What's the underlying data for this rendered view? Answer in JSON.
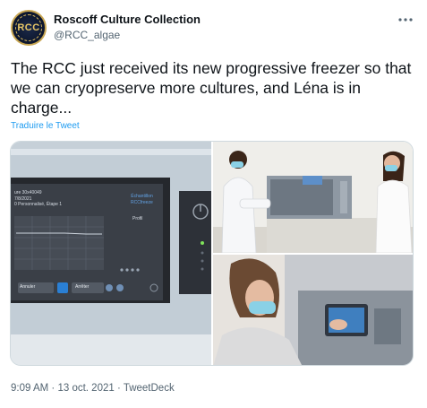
{
  "author": {
    "display_name": "Roscoff Culture Collection",
    "handle": "@RCC_algae",
    "avatar_text": "RCC"
  },
  "tweet": {
    "text": "The RCC just received its new progressive freezer so that we can cryopreserve more cultures, and Léna is in charge...",
    "translate_label": "Traduire le Tweet",
    "time": "9:09 AM",
    "date": "13 oct. 2021",
    "source": "TweetDeck",
    "separator": "·"
  },
  "media": {
    "screen_lines": [
      "ure 30x40049",
      "7/8/2021",
      "0 Personnalisé, Étape 1"
    ],
    "screen_right": [
      "Échantillon",
      "RCCfreeze"
    ],
    "screen_buttons": [
      "Annuler",
      "Arrêter"
    ],
    "screen_panel_title": "Profil"
  },
  "colors": {
    "accent": "#1d9bf0",
    "text": "#0f1419",
    "secondary": "#536471",
    "border": "#cfd9de"
  },
  "icons": {
    "more": "more-horizontal-icon"
  }
}
